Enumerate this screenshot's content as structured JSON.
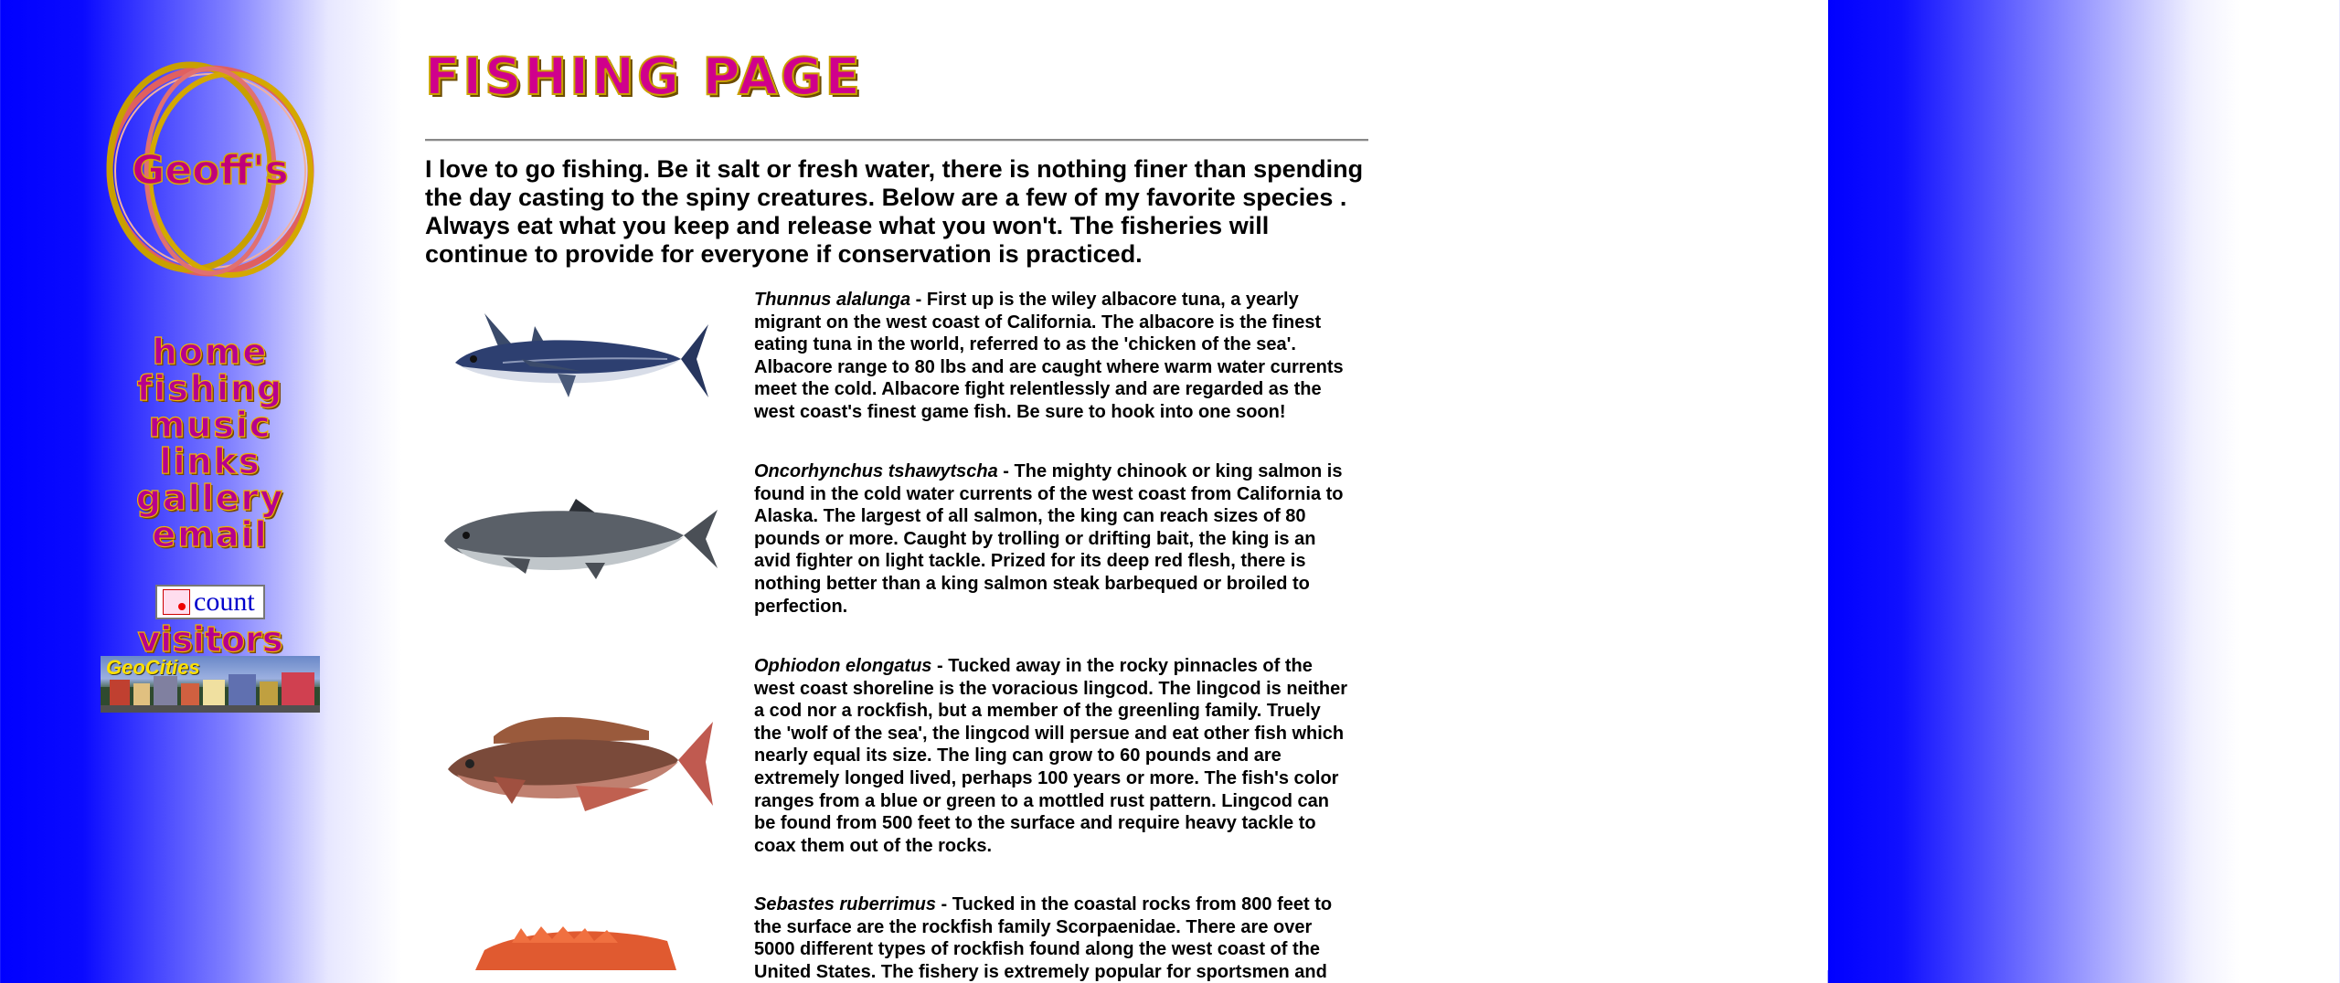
{
  "logo": {
    "text": "Geoff's"
  },
  "nav": {
    "items": [
      "home",
      "fishing",
      "music",
      "links",
      "gallery",
      "email"
    ]
  },
  "counter": {
    "text": "count"
  },
  "visitors": "visitors",
  "geocities": {
    "text": "GeoCities"
  },
  "page": {
    "title": "FISHING PAGE",
    "intro": "I love to go fishing. Be it salt or fresh water, there is nothing finer than spending the day casting to the spiny creatures. Below are a few of my favorite species . Always eat what you keep and release what you won't. The fisheries will continue to provide for everyone if conservation is practiced."
  },
  "species": [
    {
      "name": "Thunnus alalunga",
      "sep": " - ",
      "text": "First up is the wiley albacore tuna, a yearly migrant on the west coast of California. The albacore is the finest eating tuna in the world, referred to as the 'chicken of the sea'. Albacore range to 80 lbs and are caught where warm water currents meet the cold. Albacore fight relentlessly and are regarded as the west coast's finest game fish. Be sure to hook into one soon!"
    },
    {
      "name": "Oncorhynchus tshawytscha",
      "sep": " - ",
      "text": "The mighty chinook or king salmon is found in the cold water currents of the west coast from California to Alaska. The largest of all salmon, the king can reach sizes of 80 pounds or more. Caught by trolling or drifting bait, the king is an avid fighter on light tackle. Prized for its deep red flesh, there is nothing better than a king salmon steak barbequed or broiled to perfection."
    },
    {
      "name": "Ophiodon elongatus",
      "sep": " - ",
      "text": "Tucked away in the rocky pinnacles of the west coast shoreline is the voracious lingcod. The lingcod is neither a cod nor a rockfish, but a member of the greenling family. Truely the 'wolf of the sea', the lingcod will persue and eat other fish which nearly equal its size. The ling can grow to 60 pounds and are extremely longed lived, perhaps 100 years or more. The fish's color ranges from a blue or green to a mottled rust pattern. Lingcod can be found from 500 feet to the surface and require heavy tackle to coax them out of the rocks."
    },
    {
      "name": "Sebastes ruberrimus",
      "sep": " - ",
      "text": "Tucked in the coastal rocks from 800 feet to the surface are the rockfish family Scorpaenidae. There are over 5000 different types of rockfish found along the west coast of the United States. The fishery is extremely popular for sportsmen and"
    }
  ],
  "colors": {
    "left_bg": "#0000ff",
    "nav_fill": "#b6008e",
    "nav_outline": "#f0b400"
  }
}
